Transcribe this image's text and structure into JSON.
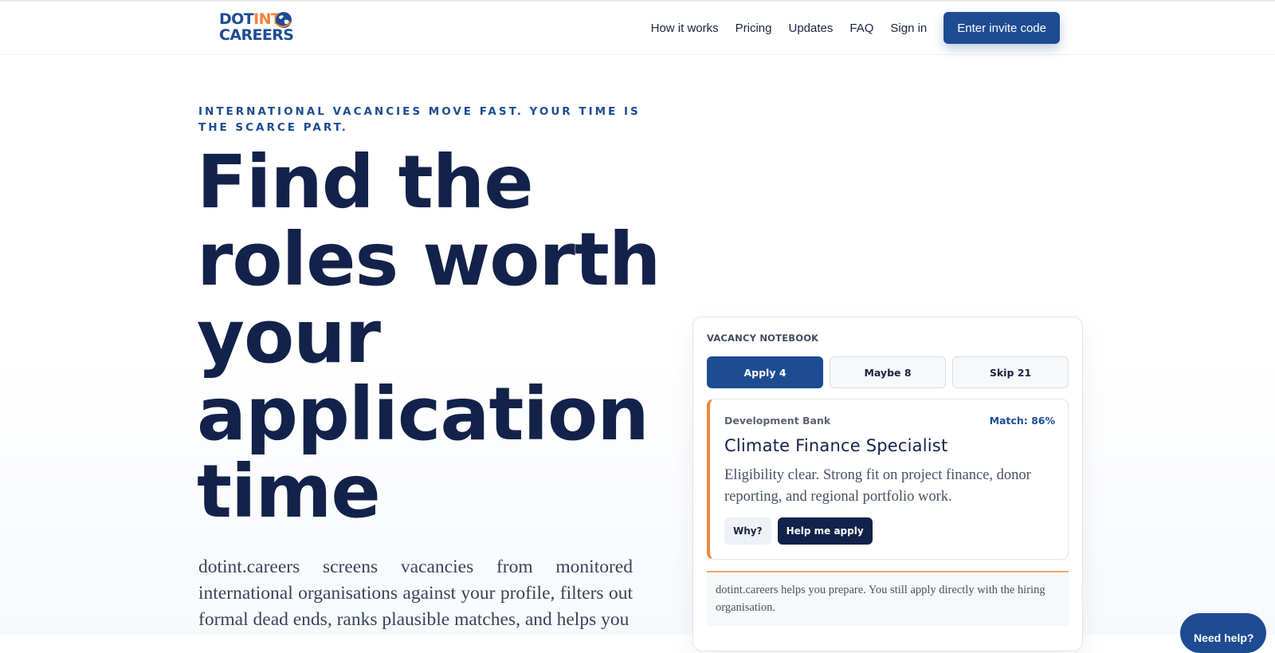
{
  "header": {
    "logo": {
      "line1": "DOTINT",
      "line1_main": "DOT",
      "line1_accent": "INT",
      "line2": "CAREERS"
    },
    "nav": [
      {
        "label": "How it works"
      },
      {
        "label": "Pricing"
      },
      {
        "label": "Updates"
      },
      {
        "label": "FAQ"
      },
      {
        "label": "Sign in"
      }
    ],
    "cta_label": "Enter invite code"
  },
  "hero": {
    "eyebrow": "International vacancies move fast. Your time is the scarce part.",
    "title": "Find the roles worth your application time",
    "description": "dotint.careers screens vacancies from monitored international organisations against your profile, filters out formal dead ends, ranks plausible matches, and helps you"
  },
  "notebook": {
    "label": "VACANCY NOTEBOOK",
    "tabs": [
      {
        "label": "Apply 4",
        "active": true
      },
      {
        "label": "Maybe 8",
        "active": false
      },
      {
        "label": "Skip 21",
        "active": false
      }
    ],
    "job": {
      "organisation": "Development Bank",
      "match": "Match: 86%",
      "title": "Climate Finance Specialist",
      "description": "Eligibility clear. Strong fit on project finance, donor reporting, and regional portfolio work.",
      "why_label": "Why?",
      "help_label": "Help me apply"
    },
    "note": "dotint.careers helps you prepare. You still apply directly with the hiring organisation."
  },
  "help_chat_label": "Need help?",
  "colors": {
    "brand_blue": "#1d4c92",
    "navy": "#13224a",
    "accent_orange": "#f2833a",
    "card_border": "#dfe3ea"
  }
}
